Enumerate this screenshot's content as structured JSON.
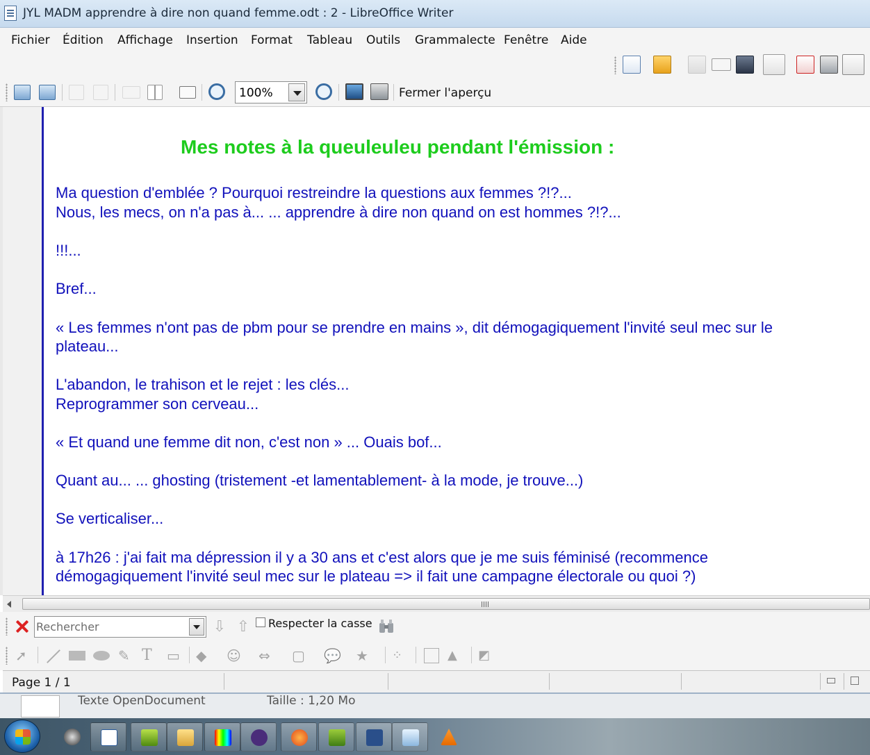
{
  "window": {
    "title": "JYL    MADM apprendre à dire non quand femme.odt : 2 - LibreOffice Writer"
  },
  "menu": [
    {
      "label": "Fichier"
    },
    {
      "label": "Édition"
    },
    {
      "label": "Affichage"
    },
    {
      "label": "Insertion"
    },
    {
      "label": "Format"
    },
    {
      "label": "Tableau"
    },
    {
      "label": "Outils"
    },
    {
      "label": "Grammalecte"
    },
    {
      "label": "Fenêtre"
    },
    {
      "label": "Aide"
    }
  ],
  "standard_toolbar": {
    "icons": [
      "new-document-icon",
      "open-folder-icon",
      "save-icon",
      "email-icon",
      "save-email-icon",
      "edit-mode-icon",
      "export-pdf-icon",
      "print-icon",
      "print-preview-icon"
    ]
  },
  "preview_toolbar": {
    "zoom_value": "100%",
    "close_preview_label": "Fermer l'aperçu",
    "icons": [
      "previous-page-icon",
      "next-page-icon",
      "first-page-icon",
      "last-page-icon",
      "two-pages-icon",
      "multiple-pages-icon",
      "book-preview-icon",
      "zoom-in-icon",
      "zoom-out-icon",
      "full-screen-icon",
      "print-options-icon"
    ]
  },
  "document": {
    "heading": "Mes notes à la queuleuleu pendant l'émission :",
    "lines": [
      "Ma question d'emblée ? Pourquoi restreindre  la questions aux femmes ?!?...",
      "Nous, les mecs, on n'a pas à... ... apprendre à dire non quand on est hommes ?!?...",
      "!!!...",
      "Bref...",
      "« Les femmes n'ont pas de pbm pour se prendre en mains », dit démogagiquement l'invité seul mec sur le",
      "plateau...",
      "L'abandon, le trahison et le rejet : les clés...",
      "Reprogrammer son cerveau...",
      "« Et quand une femme dit non, c'est non » ...  Ouais bof...",
      "Quant au... ... ghosting (tristement -et lamentablement- à la mode, je trouve...)",
      "Se verticaliser...",
      "à 17h26 : j'ai fait ma dépression il y a 30 ans et c'est alors que je me suis féminisé (recommence",
      "démogagiquement l'invité seul mec sur le plateau => il fait une campagne électorale ou quoi ?)"
    ],
    "colors": {
      "heading": "#1dcc1d",
      "body": "#1111bb"
    }
  },
  "find_toolbar": {
    "search_placeholder": "Rechercher",
    "match_case_label": "Respecter la casse"
  },
  "status_bar": {
    "page_label": "Page 1 / 1"
  },
  "behind_window": {
    "file_type": "Texte OpenDocument",
    "size": "Taille : 1,20 Mo"
  },
  "taskbar": {
    "items": [
      "vlc-like-icon",
      "writer-icon",
      "green-app-icon",
      "folder-icon",
      "color-app-icon",
      "mei-icon",
      "firefox-icon",
      "torrent-icon",
      "twp-icon",
      "notepad-icon",
      "vlc-icon"
    ]
  }
}
